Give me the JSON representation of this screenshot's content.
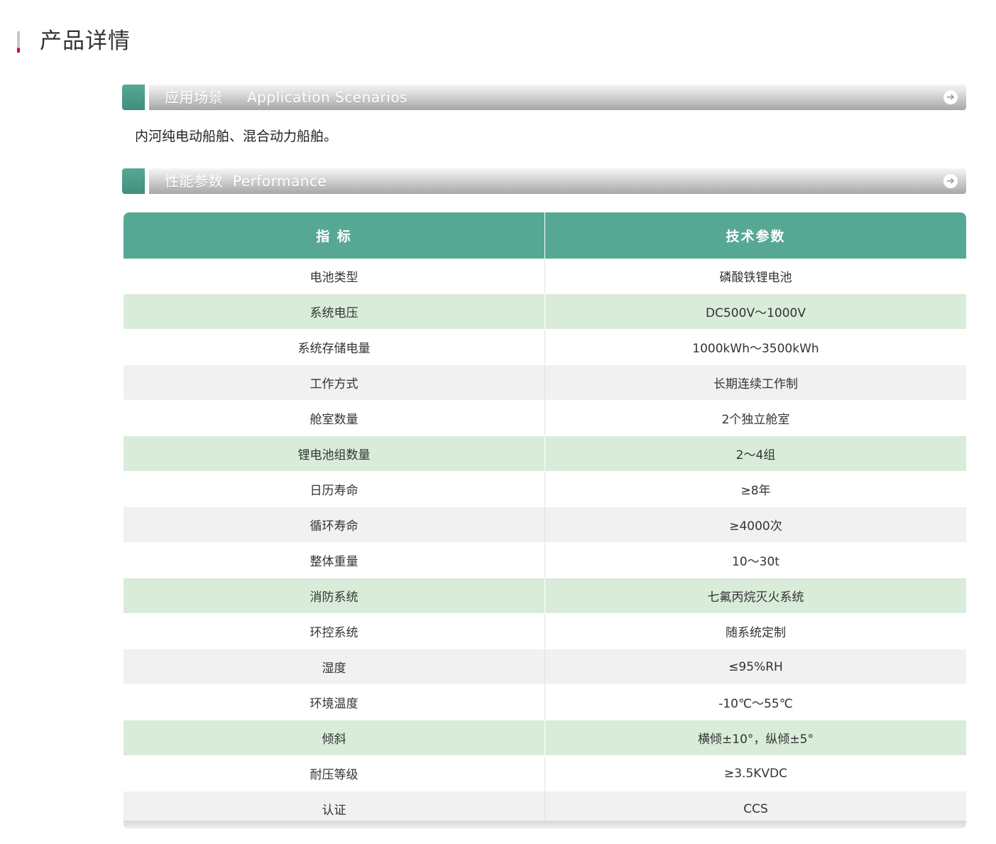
{
  "page": {
    "title": "产品详情"
  },
  "colors": {
    "accent_green": "#56a894",
    "row_green": "#d8ecd9",
    "row_gray": "#f1f1f1",
    "title_marker_red": "#d2102c"
  },
  "sections": [
    {
      "title_zh": "应用场景",
      "title_en": "Application Scenarios",
      "arrow_icon": "arrow-right-circle-icon"
    },
    {
      "title_zh": "性能参数",
      "title_en": "Performance",
      "arrow_icon": "arrow-right-circle-icon"
    }
  ],
  "scenario": {
    "text": "内河纯电动船舶、混合动力船舶。"
  },
  "table": {
    "headers": [
      "指 标",
      "技术参数"
    ],
    "rows": [
      {
        "label": "电池类型",
        "value": "磷酸铁锂电池",
        "style": "white"
      },
      {
        "label": "系统电压",
        "value": "DC500V～1000V",
        "style": "green"
      },
      {
        "label": "系统存储电量",
        "value": "1000kWh～3500kWh",
        "style": "white"
      },
      {
        "label": "工作方式",
        "value": "长期连续工作制",
        "style": "gray"
      },
      {
        "label": "舱室数量",
        "value": "2个独立舱室",
        "style": "white"
      },
      {
        "label": "锂电池组数量",
        "value": "2～4组",
        "style": "green"
      },
      {
        "label": "日历寿命",
        "value": "≥8年",
        "style": "white"
      },
      {
        "label": "循环寿命",
        "value": "≥4000次",
        "style": "gray"
      },
      {
        "label": "整体重量",
        "value": "10～30t",
        "style": "white"
      },
      {
        "label": "消防系统",
        "value": "七氟丙烷灭火系统",
        "style": "green"
      },
      {
        "label": "环控系统",
        "value": "随系统定制",
        "style": "white"
      },
      {
        "label": "湿度",
        "value": "≤95%RH",
        "style": "gray"
      },
      {
        "label": "环境温度",
        "value": "-10℃～55℃",
        "style": "white"
      },
      {
        "label": "倾斜",
        "value": "横倾±10°，纵倾±5°",
        "style": "green"
      },
      {
        "label": "耐压等级",
        "value": "≥3.5KVDC",
        "style": "white"
      },
      {
        "label": "认证",
        "value": "CCS",
        "style": "gray"
      }
    ]
  }
}
